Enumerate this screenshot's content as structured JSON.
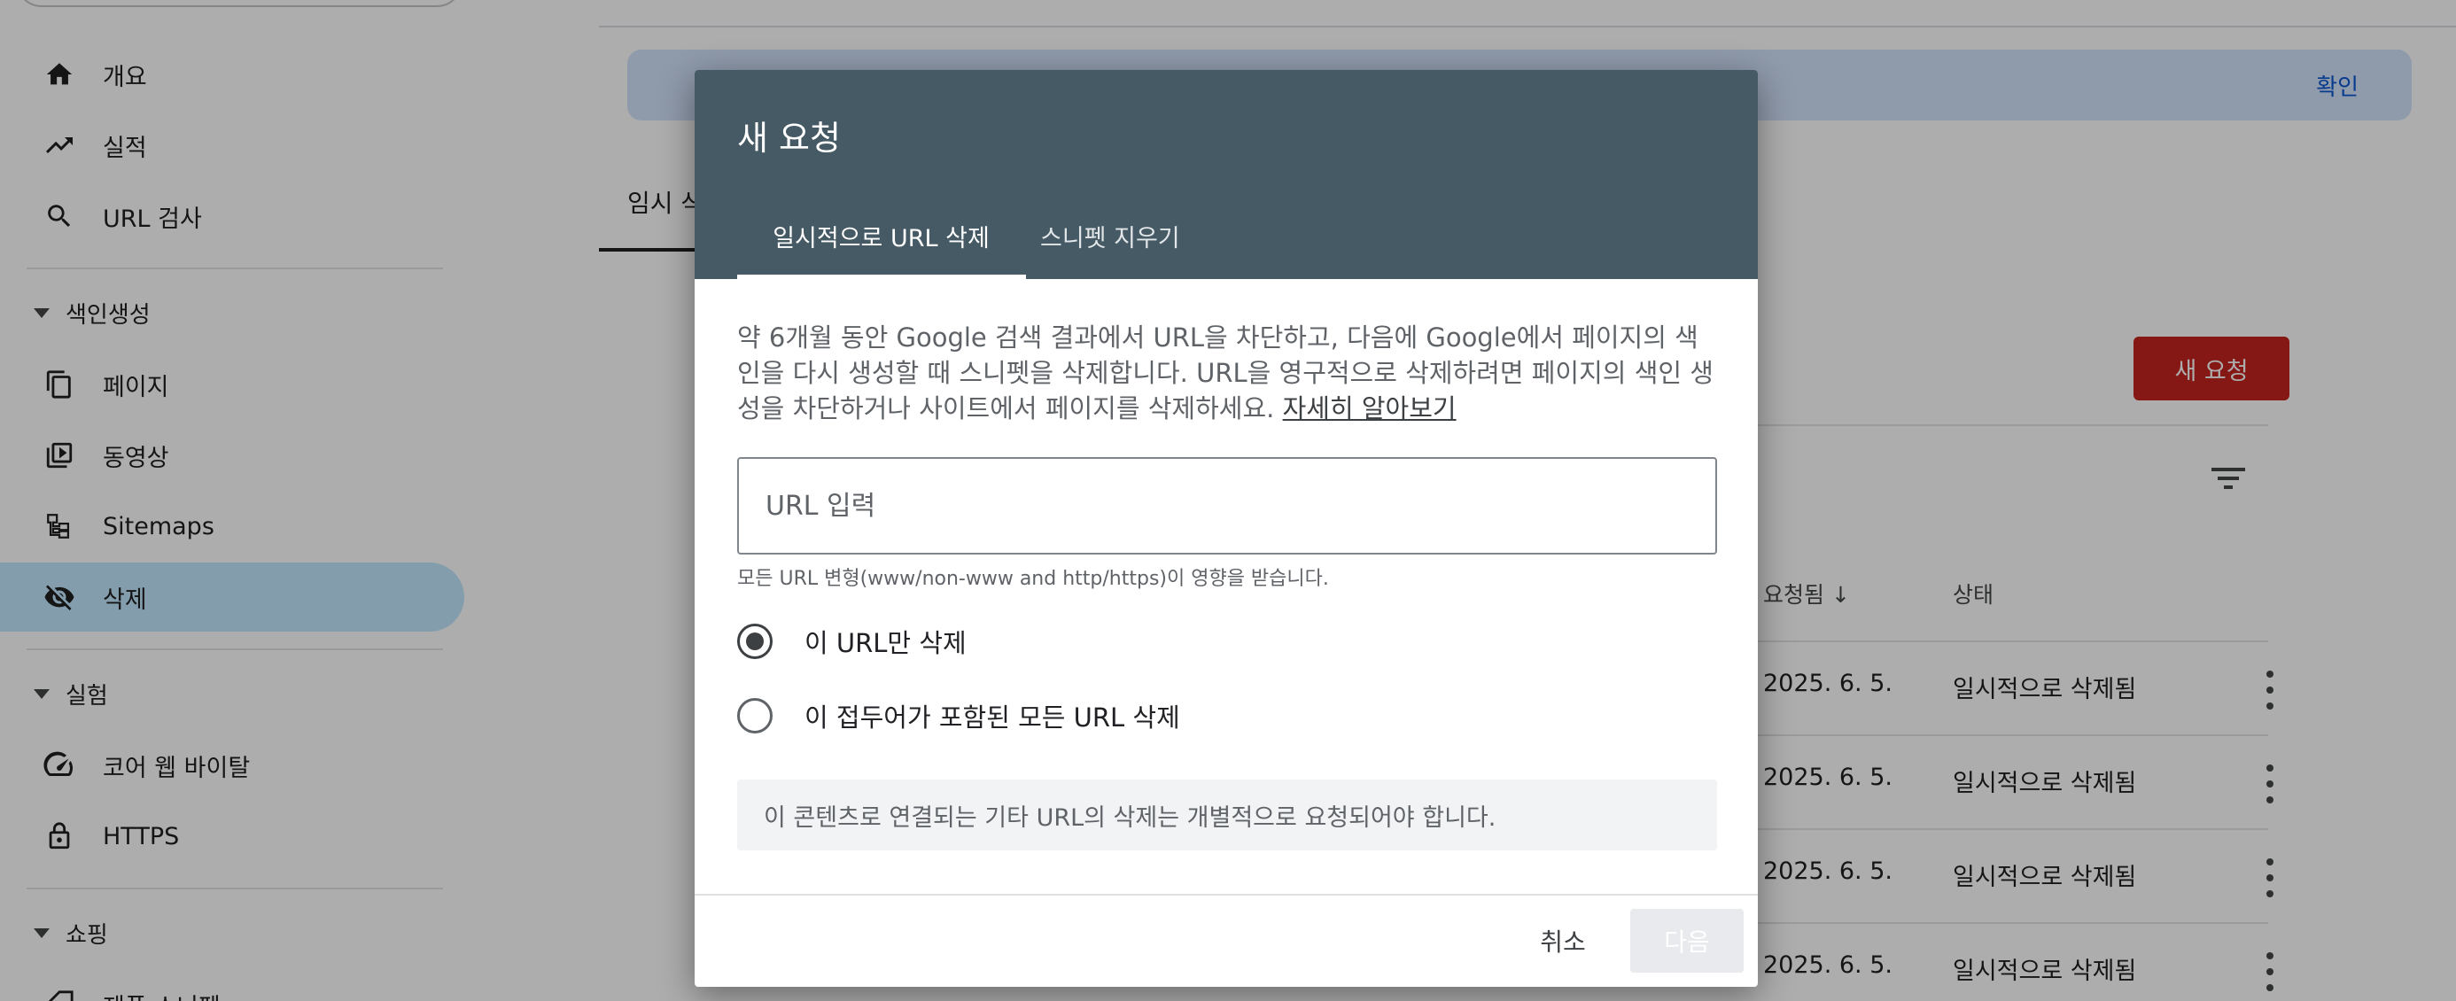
{
  "sidebar": {
    "items": [
      {
        "name": "overview",
        "label": "개요",
        "icon": "home-icon"
      },
      {
        "name": "performance",
        "label": "실적",
        "icon": "trending-up-icon"
      },
      {
        "name": "url-inspection",
        "label": "URL 검사",
        "icon": "search-icon"
      }
    ],
    "indexing_section": "색인생성",
    "indexing_items": [
      {
        "name": "pages",
        "label": "페이지",
        "icon": "pages-icon"
      },
      {
        "name": "videos",
        "label": "동영상",
        "icon": "video-icon"
      },
      {
        "name": "sitemaps",
        "label": "Sitemaps",
        "icon": "sitemap-icon"
      },
      {
        "name": "removals",
        "label": "삭제",
        "icon": "visibility-off-icon",
        "active": true
      }
    ],
    "experience_section": "실험",
    "experience_items": [
      {
        "name": "core-web-vitals",
        "label": "코어 웹 바이탈",
        "icon": "speed-icon"
      },
      {
        "name": "https",
        "label": "HTTPS",
        "icon": "lock-icon"
      }
    ],
    "shopping_section": "쇼핑",
    "shopping_partial_label": "제품 스니펫"
  },
  "main": {
    "banner_confirm": "확인",
    "tab_partial": "임시 삭",
    "new_request_button": "새 요청",
    "columns": {
      "requested": "요청됨",
      "status": "상태"
    },
    "rows": [
      {
        "date": "2025. 6. 5.",
        "status": "일시적으로 삭제됨"
      },
      {
        "date": "2025. 6. 5.",
        "status": "일시적으로 삭제됨"
      },
      {
        "date": "2025. 6. 5.",
        "status": "일시적으로 삭제됨"
      },
      {
        "date": "2025. 6. 5.",
        "status": "일시적으로 삭제됨"
      }
    ]
  },
  "dialog": {
    "title": "새 요청",
    "tabs": [
      {
        "label": "일시적으로 URL 삭제",
        "active": true
      },
      {
        "label": "스니펫 지우기",
        "active": false
      }
    ],
    "description": "약 6개월 동안 Google 검색 결과에서 URL을 차단하고, 다음에 Google에서 페이지의 색인을 다시 생성할 때 스니펫을 삭제합니다. URL을 영구적으로 삭제하려면 페이지의 색인 생성을 차단하거나 사이트에서 페이지를 삭제하세요.",
    "learn_more": "자세히 알아보기",
    "url_placeholder": "URL 입력",
    "url_value": "",
    "helper": "모든 URL 변형(www/non-www and http/https)이 영향을 받습니다.",
    "options": [
      {
        "label": "이 URL만 삭제",
        "checked": true
      },
      {
        "label": "이 접두어가 포함된 모든 URL 삭제",
        "checked": false
      }
    ],
    "note": "이 콘텐츠로 연결되는 기타 URL의 삭제는 개별적으로 요청되어야 합니다.",
    "cancel": "취소",
    "next": "다음"
  },
  "colors": {
    "dialog_header": "#455a64",
    "primary_red": "#c5221f",
    "active_nav": "#c2e7ff",
    "banner": "#d3e3fd"
  }
}
